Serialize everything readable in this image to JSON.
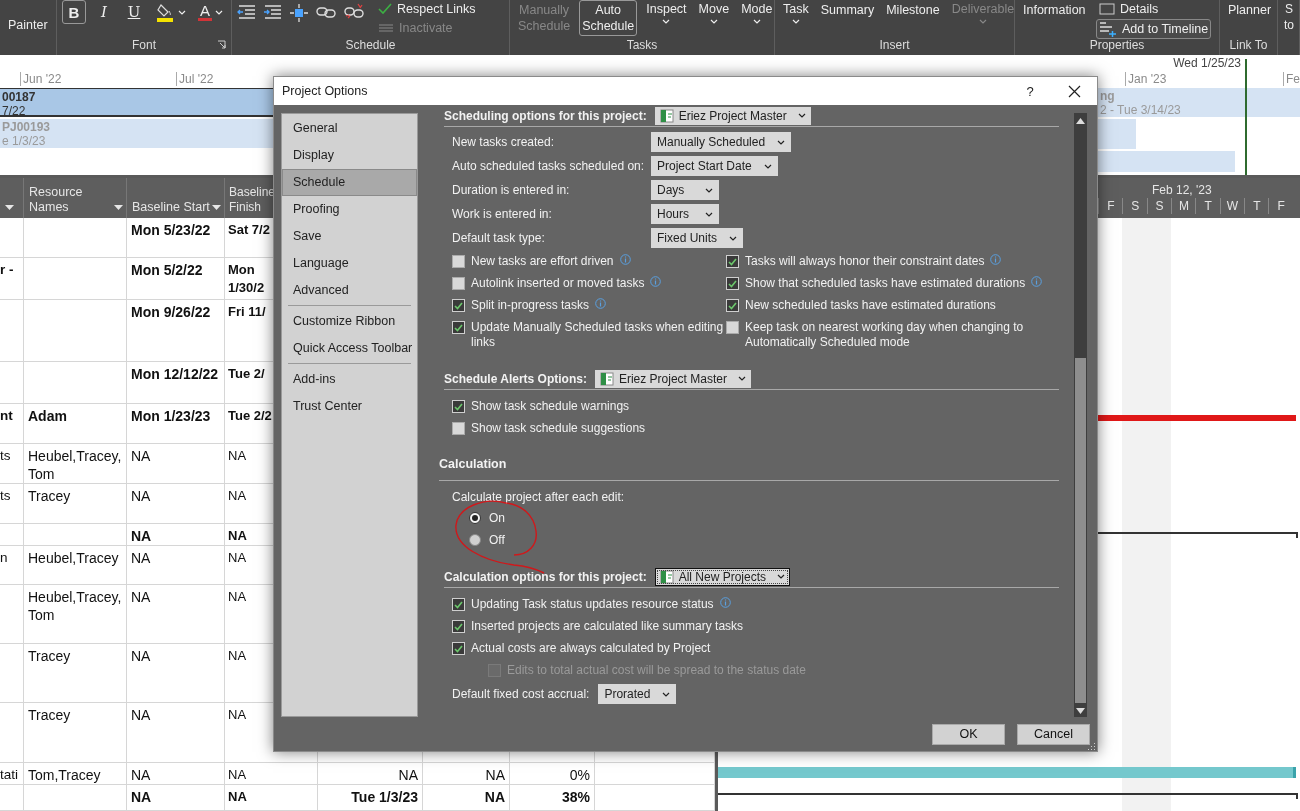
{
  "ribbon": {
    "groups": [
      {
        "items": [
          {
            "kind": "text",
            "label": "Painter"
          }
        ]
      },
      {
        "label": "Font",
        "launcher": true,
        "items": [
          {
            "kind": "glyph",
            "label": "B",
            "selected": true
          },
          {
            "kind": "glyph",
            "label": "I",
            "selected": false
          },
          {
            "kind": "glyph",
            "label": "U",
            "selected": false
          },
          {
            "kind": "highlight"
          },
          {
            "kind": "font-color",
            "label": "A"
          }
        ]
      },
      {
        "label": "Schedule",
        "items": [
          {
            "kind": "outdent"
          },
          {
            "kind": "indent"
          },
          {
            "kind": "split"
          },
          {
            "kind": "link"
          },
          {
            "kind": "unlink"
          },
          {
            "kind": "stack",
            "entries": [
              {
                "kind": "respect",
                "label": "Respect Links",
                "disabled": false,
                "selected": false
              },
              {
                "kind": "inactivate",
                "label": "Inactivate",
                "disabled": true,
                "selected": false
              }
            ]
          }
        ]
      },
      {
        "label": "Tasks",
        "items": [
          {
            "kind": "big",
            "label": "Manually Schedule",
            "disabled": true,
            "selected": false
          },
          {
            "kind": "big",
            "label": "Auto Schedule",
            "disabled": false,
            "selected": true
          },
          {
            "kind": "menu",
            "label": "Inspect",
            "disabled": false
          },
          {
            "kind": "menu",
            "label": "Move",
            "disabled": false
          },
          {
            "kind": "menu",
            "label": "Mode",
            "disabled": false
          }
        ]
      },
      {
        "label": "Insert",
        "items": [
          {
            "kind": "menu",
            "label": "Task",
            "disabled": false
          },
          {
            "kind": "big",
            "label": "Summary",
            "disabled": false,
            "selected": false
          },
          {
            "kind": "big",
            "label": "Milestone",
            "disabled": false,
            "selected": false
          },
          {
            "kind": "menu",
            "label": "Deliverable",
            "disabled": true
          }
        ]
      },
      {
        "label": "Properties",
        "items": [
          {
            "kind": "big",
            "label": "Information",
            "disabled": false,
            "selected": false
          },
          {
            "kind": "stack",
            "entries": [
              {
                "kind": "details",
                "label": "Details",
                "disabled": false,
                "selected": false
              },
              {
                "kind": "timeline",
                "label": "Add to Timeline",
                "disabled": false,
                "selected": true
              }
            ]
          }
        ]
      },
      {
        "label": "Link To",
        "items": [
          {
            "kind": "big",
            "label": "Planner",
            "disabled": false,
            "selected": false
          }
        ]
      },
      {
        "items": [
          {
            "kind": "big",
            "label": "S to",
            "disabled": false,
            "selected": false
          }
        ]
      }
    ]
  },
  "timeline": {
    "months": [
      {
        "label": "Jun '22"
      },
      {
        "label": "Jul '22"
      },
      {
        "label": "Jan '23"
      },
      {
        "label": "Fe"
      }
    ],
    "today": "Wed 1/25/23",
    "bars": [
      {
        "title": "00187",
        "dates": "7/22",
        "selected": true
      },
      {
        "title": "PJ00193",
        "dates": "e 1/3/23",
        "selected": false
      },
      {
        "title": "ng",
        "dates": "2 - Tue 3/14/23",
        "selected": false
      }
    ]
  },
  "table": {
    "columns": [
      {
        "label": "Resource Names"
      },
      {
        "label": "Baseline Start"
      },
      {
        "label": "Baseline Finish"
      }
    ],
    "rows": [
      {
        "bold": true,
        "baseline_start": "Mon 5/23/22",
        "baseline_finish": "Sat 7/2"
      },
      {
        "bold": true,
        "column_1": "r -",
        "baseline_start": "Mon 5/2/22",
        "baseline_finish": "Mon 1/30/2"
      },
      {
        "bold": true,
        "baseline_start": "Mon 9/26/22",
        "baseline_finish": "Fri 11/"
      },
      {
        "bold": true,
        "baseline_start": "Mon 12/12/22",
        "baseline_finish": "Tue 2/"
      },
      {
        "bold": true,
        "column_1": "nt",
        "resource_names": "Adam",
        "baseline_start": "Mon 1/23/23",
        "baseline_finish": "Tue 2/2",
        "gantt_bar": {
          "kind": "critical"
        }
      },
      {
        "bold": false,
        "column_1": "ts",
        "resource_names": "Heubel,Tracey, Tom",
        "baseline_start": "NA",
        "baseline_finish": "NA"
      },
      {
        "bold": false,
        "column_1": "ts",
        "resource_names": "Tracey",
        "baseline_start": "NA",
        "baseline_finish": "NA"
      },
      {
        "bold": true,
        "baseline_start": "NA",
        "baseline_finish": "NA",
        "gantt_bar": {
          "kind": "summary"
        }
      },
      {
        "bold": false,
        "column_1": "n",
        "resource_names": "Heubel,Tracey",
        "baseline_start": "NA",
        "baseline_finish": "NA"
      },
      {
        "bold": false,
        "resource_names": "Heubel,Tracey, Tom",
        "baseline_start": "NA",
        "baseline_finish": "NA"
      },
      {
        "bold": false,
        "resource_names": "Tracey",
        "baseline_start": "NA",
        "baseline_finish": "NA"
      },
      {
        "bold": false,
        "resource_names": "Tracey",
        "baseline_start": "NA",
        "baseline_finish": "NA"
      },
      {
        "bold": false,
        "column_1": "tati",
        "resource_names": "Tom,Tracey",
        "baseline_start": "NA",
        "baseline_finish": "NA",
        "column_5": "NA",
        "column_6": "NA",
        "column_7": "0%",
        "gantt_bar": {
          "kind": "task"
        }
      },
      {
        "bold": true,
        "baseline_start": "NA",
        "baseline_finish": "NA",
        "column_5": "Tue 1/3/23",
        "column_6": "NA",
        "column_7": "38%",
        "gantt_bar": {
          "kind": "summary"
        }
      }
    ]
  },
  "gantt": {
    "week_label": "Feb 12, '23",
    "days": [
      "F",
      "S",
      "S",
      "M",
      "T",
      "W",
      "T",
      "F"
    ]
  },
  "dialog": {
    "title": "Project Options",
    "help": "?",
    "nav_groups": [
      {
        "items": [
          {
            "label": "General",
            "selected": false
          },
          {
            "label": "Display",
            "selected": false
          },
          {
            "label": "Schedule",
            "selected": true
          },
          {
            "label": "Proofing",
            "selected": false
          },
          {
            "label": "Save",
            "selected": false
          },
          {
            "label": "Language",
            "selected": false
          },
          {
            "label": "Advanced",
            "selected": false
          }
        ]
      },
      {
        "items": [
          {
            "label": "Customize Ribbon",
            "selected": false
          },
          {
            "label": "Quick Access Toolbar",
            "selected": false
          }
        ]
      },
      {
        "items": [
          {
            "label": "Add-ins",
            "selected": false
          },
          {
            "label": "Trust Center",
            "selected": false
          }
        ]
      }
    ],
    "content": [
      {
        "kind": "section",
        "label": "Scheduling options for this project:",
        "dropdown": "Eriez Project Master",
        "focused": false
      },
      {
        "kind": "select-grid",
        "rows": [
          {
            "label": "New tasks created:",
            "value": "Manually Scheduled"
          },
          {
            "label": "Auto scheduled tasks scheduled on:",
            "value": "Project Start Date"
          },
          {
            "label": "Duration is entered in:",
            "value": "Days"
          },
          {
            "label": "Work is entered in:",
            "value": "Hours"
          },
          {
            "label": "Default task type:",
            "value": "Fixed Units"
          }
        ]
      },
      {
        "kind": "check-grid",
        "items": [
          {
            "label": "New tasks are effort driven",
            "checked": false,
            "info": true,
            "disabled": false
          },
          {
            "label": "Tasks will always honor their constraint dates",
            "checked": true,
            "info": true,
            "disabled": false
          },
          {
            "label": "Autolink inserted or moved tasks",
            "checked": false,
            "info": true,
            "disabled": false
          },
          {
            "label": "Show that scheduled tasks have estimated durations",
            "checked": true,
            "info": true,
            "disabled": false
          },
          {
            "label": "Split in-progress tasks",
            "checked": true,
            "info": true,
            "disabled": false
          },
          {
            "label": "New scheduled tasks have estimated durations",
            "checked": true,
            "info": false,
            "disabled": false
          },
          {
            "label": "Update Manually Scheduled tasks when editing links",
            "checked": true,
            "info": false,
            "disabled": false
          },
          {
            "label": "Keep task on nearest working day when changing to Automatically Scheduled mode",
            "checked": false,
            "info": false,
            "disabled": false
          }
        ]
      },
      {
        "kind": "section",
        "label": "Schedule Alerts Options:",
        "dropdown": "Eriez Project Master",
        "focused": false
      },
      {
        "kind": "check",
        "label": "Show task schedule warnings",
        "checked": true,
        "info": false,
        "disabled": false
      },
      {
        "kind": "check",
        "label": "Show task schedule suggestions",
        "checked": false,
        "info": false,
        "disabled": false
      },
      {
        "kind": "heading",
        "label": "Calculation"
      },
      {
        "kind": "text",
        "label": "Calculate project after each edit:"
      },
      {
        "kind": "radio-group",
        "options": [
          {
            "label": "On",
            "selected": true
          },
          {
            "label": "Off",
            "selected": false
          }
        ]
      },
      {
        "kind": "section",
        "label": "Calculation options for this project:",
        "dropdown": "All New Projects",
        "focused": true
      },
      {
        "kind": "check",
        "label": "Updating Task status updates resource status",
        "checked": true,
        "info": true,
        "disabled": false
      },
      {
        "kind": "check",
        "label": "Inserted projects are calculated like summary tasks",
        "checked": true,
        "info": false,
        "disabled": false
      },
      {
        "kind": "check",
        "label": "Actual costs are always calculated by Project",
        "checked": true,
        "info": false,
        "disabled": false
      },
      {
        "kind": "check",
        "label": "Edits to total actual cost will be spread to the status date",
        "checked": false,
        "info": false,
        "disabled": true
      },
      {
        "kind": "select",
        "label": "Default fixed cost accrual:",
        "value": "Prorated"
      }
    ],
    "buttons": [
      {
        "label": "OK"
      },
      {
        "label": "Cancel"
      }
    ]
  }
}
